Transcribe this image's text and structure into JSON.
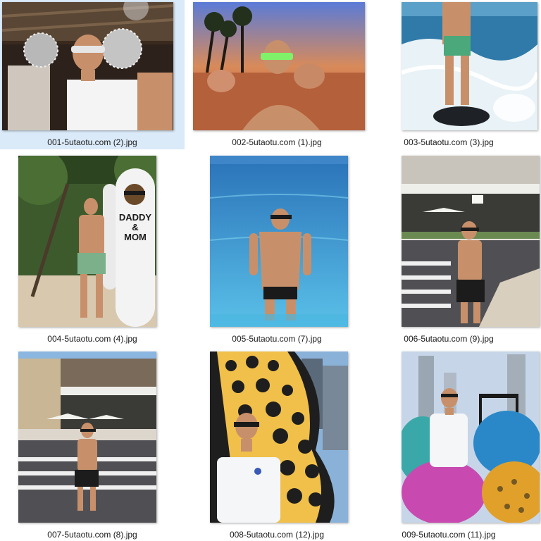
{
  "explorer": {
    "files": [
      {
        "name": "001-5utaotu.com (2).jpg",
        "selected": true
      },
      {
        "name": "002-5utaotu.com (1).jpg",
        "selected": false
      },
      {
        "name": "003-5utaotu.com (3).jpg",
        "selected": false
      },
      {
        "name": "004-5utaotu.com (4).jpg",
        "selected": false
      },
      {
        "name": "005-5utaotu.com (7).jpg",
        "selected": false
      },
      {
        "name": "006-5utaotu.com (9).jpg",
        "selected": false
      },
      {
        "name": "007-5utaotu.com (8).jpg",
        "selected": false
      },
      {
        "name": "008-5utaotu.com (12).jpg",
        "selected": false
      },
      {
        "name": "009-5utaotu.com (11).jpg",
        "selected": false
      }
    ]
  },
  "surfboard_text": [
    "DADDY",
    "&",
    "MOM"
  ],
  "colors": {
    "selection": "#dbeaf9",
    "sky": "#6aa7e8",
    "sea": "#3fa6d9",
    "skin": "#c8906a"
  }
}
